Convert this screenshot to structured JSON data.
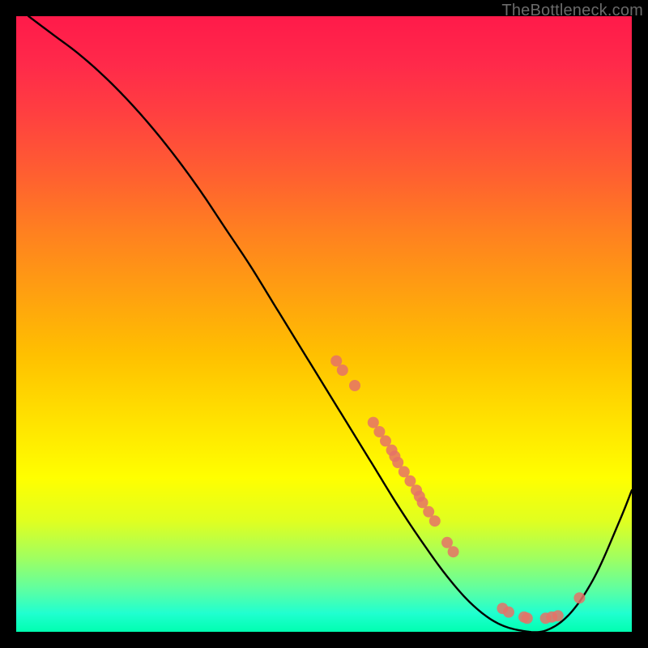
{
  "watermark": "TheBottleneck.com",
  "chart_data": {
    "type": "line",
    "title": "",
    "xlabel": "",
    "ylabel": "",
    "xlim": [
      0,
      100
    ],
    "ylim": [
      0,
      100
    ],
    "curve": {
      "name": "bottleneck-curve",
      "x": [
        2,
        6,
        10,
        14,
        18,
        22,
        26,
        30,
        34,
        38,
        42,
        46,
        50,
        54,
        58,
        62,
        66,
        70,
        74,
        78,
        82,
        86,
        90,
        94,
        98,
        100
      ],
      "y": [
        100,
        97,
        94,
        90.5,
        86.5,
        82,
        77,
        71.5,
        65.5,
        59.5,
        53,
        46.5,
        40,
        33.5,
        27,
        20.5,
        14.5,
        9,
        4.5,
        1.5,
        0.2,
        0.2,
        3,
        9,
        18,
        23
      ]
    },
    "scatter": {
      "name": "highlight-points",
      "color": "#e57267",
      "points": [
        {
          "x": 52,
          "y": 44
        },
        {
          "x": 53,
          "y": 42.5
        },
        {
          "x": 55,
          "y": 40
        },
        {
          "x": 58,
          "y": 34
        },
        {
          "x": 59,
          "y": 32.5
        },
        {
          "x": 60,
          "y": 31
        },
        {
          "x": 61,
          "y": 29.5
        },
        {
          "x": 61.5,
          "y": 28.5
        },
        {
          "x": 62,
          "y": 27.5
        },
        {
          "x": 63,
          "y": 26
        },
        {
          "x": 64,
          "y": 24.5
        },
        {
          "x": 65,
          "y": 23
        },
        {
          "x": 65.5,
          "y": 22
        },
        {
          "x": 66,
          "y": 21
        },
        {
          "x": 67,
          "y": 19.5
        },
        {
          "x": 68,
          "y": 18
        },
        {
          "x": 70,
          "y": 14.5
        },
        {
          "x": 71,
          "y": 13
        },
        {
          "x": 79,
          "y": 3.8
        },
        {
          "x": 80,
          "y": 3.2
        },
        {
          "x": 82.5,
          "y": 2.4
        },
        {
          "x": 83,
          "y": 2.2
        },
        {
          "x": 86,
          "y": 2.2
        },
        {
          "x": 87,
          "y": 2.4
        },
        {
          "x": 88,
          "y": 2.6
        },
        {
          "x": 91.5,
          "y": 5.5
        }
      ]
    }
  }
}
